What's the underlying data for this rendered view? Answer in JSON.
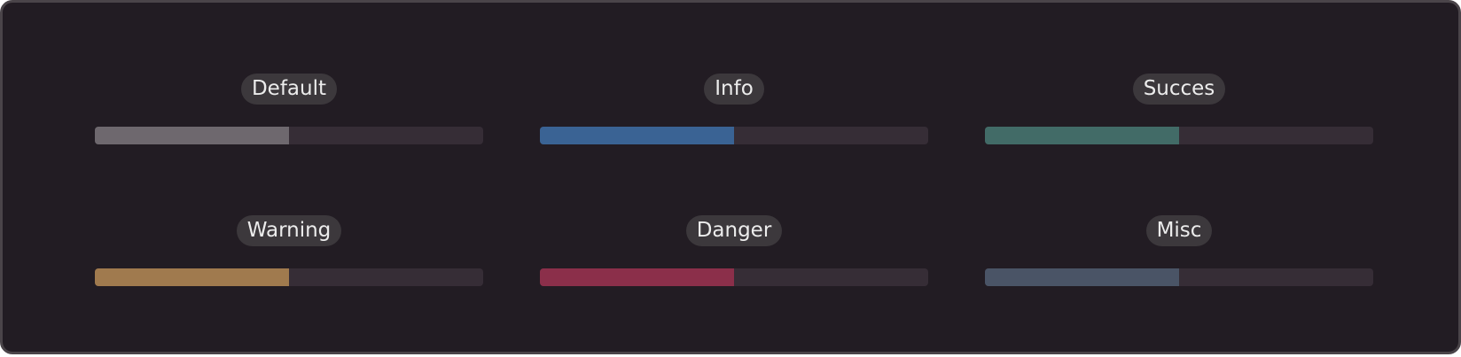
{
  "progress_bars": [
    {
      "label": "Default",
      "value": 0.5,
      "color": "#6e686e"
    },
    {
      "label": "Info",
      "value": 0.5,
      "color": "#3a6394"
    },
    {
      "label": "Succes",
      "value": 0.5,
      "color": "#426b67"
    },
    {
      "label": "Warning",
      "value": 0.5,
      "color": "#a07a4e"
    },
    {
      "label": "Danger",
      "value": 0.5,
      "color": "#8b2f4a"
    },
    {
      "label": "Misc",
      "value": 0.5,
      "color": "#4a5466"
    }
  ],
  "colors": {
    "background": "#221c23",
    "border": "#4a4449",
    "track": "#362d36",
    "label_bg": "#3c383c",
    "label_text": "#ececec"
  }
}
